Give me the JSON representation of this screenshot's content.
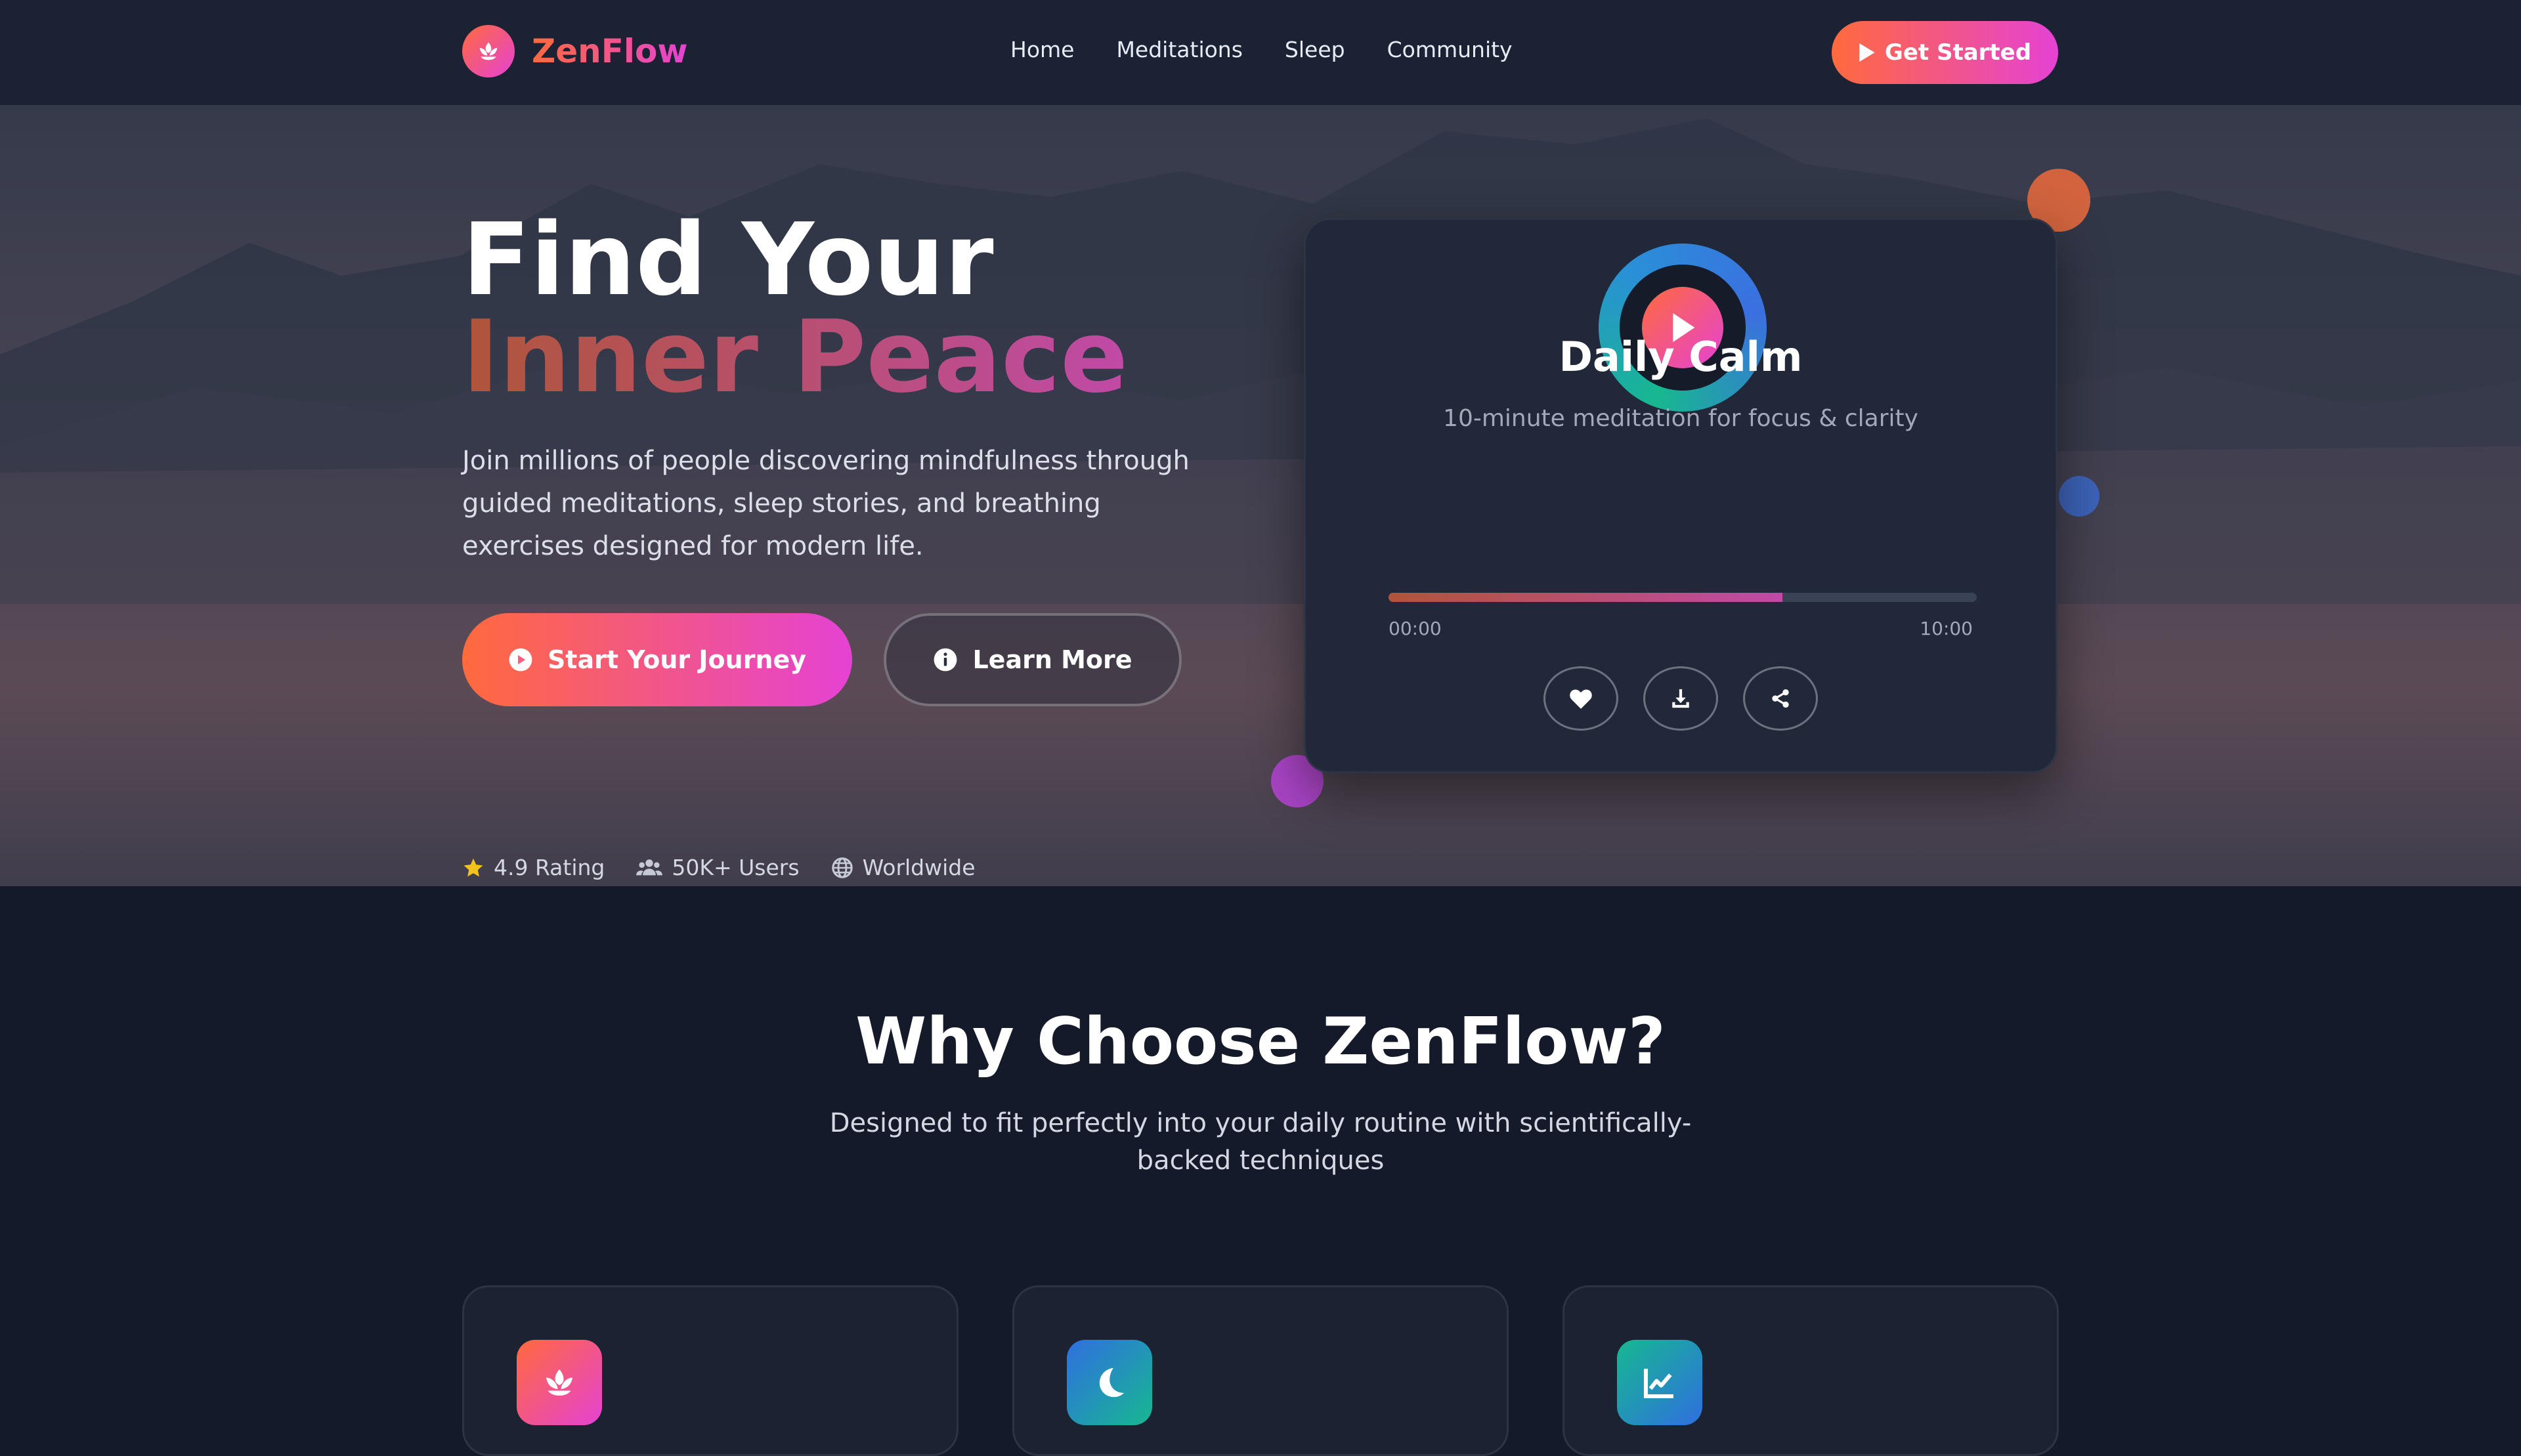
{
  "brand": {
    "name": "ZenFlow",
    "logo_icon": "lotus-icon"
  },
  "nav": {
    "links": [
      "Home",
      "Meditations",
      "Sleep",
      "Community"
    ],
    "cta_label": "Get Started"
  },
  "hero": {
    "title_line1": "Find Your",
    "title_line2": "Inner Peace",
    "description": "Join millions of people discovering mindfulness through guided meditations, sleep stories, and breathing exercises designed for modern life.",
    "primary_button": "Start Your Journey",
    "secondary_button": "Learn More",
    "stats": [
      {
        "icon": "star-icon",
        "label": "4.9 Rating"
      },
      {
        "icon": "users-icon",
        "label": "50K+ Users"
      },
      {
        "icon": "globe-icon",
        "label": "Worldwide"
      }
    ]
  },
  "player": {
    "title": "Daily Calm",
    "subtitle": "10-minute meditation for focus & clarity",
    "progress": 0.67,
    "time_start": "00:00",
    "time_end": "10:00",
    "actions": [
      "heart-icon",
      "download-icon",
      "share-icon"
    ]
  },
  "features": {
    "title": "Why Choose ZenFlow?",
    "subtitle": "Designed to fit perfectly into your daily routine with scientifically-backed techniques",
    "cards": [
      {
        "icon": "lotus-icon"
      },
      {
        "icon": "moon-icon"
      },
      {
        "icon": "chart-line-icon"
      }
    ]
  },
  "colors": {
    "accent_start": "#ff6a3d",
    "accent_end": "#e542d4",
    "background": "#141a2a",
    "nav_background": "#1b2233",
    "card_background": "#20283a"
  }
}
